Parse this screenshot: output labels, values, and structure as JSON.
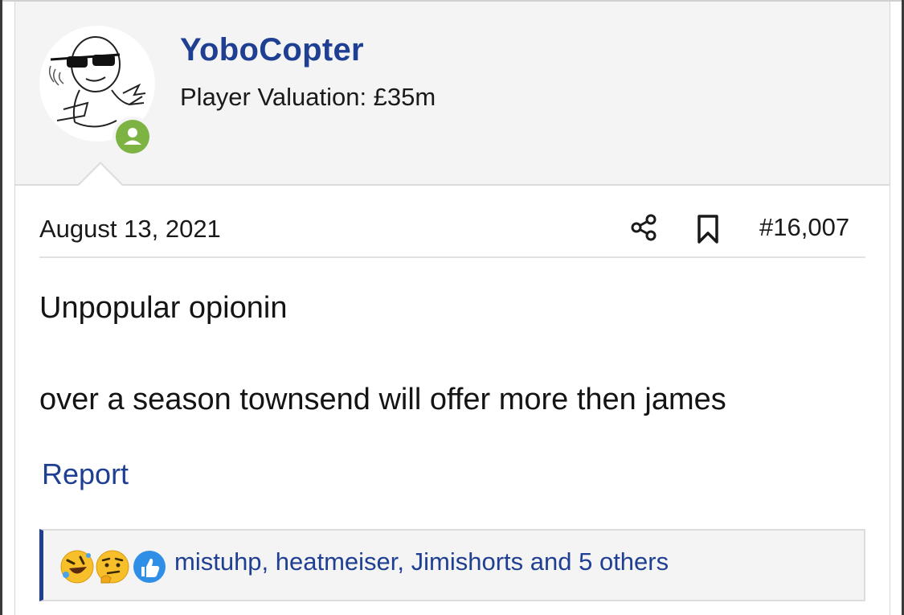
{
  "post": {
    "author": {
      "username": "YoboCopter",
      "title": "Player Valuation: £35m",
      "online_status": "online"
    },
    "date": "August 13, 2021",
    "post_number": "#16,007",
    "body": {
      "line1": "Unpopular opionin",
      "line2": "over a season townsend will offer more then james"
    },
    "actions": {
      "report_label": "Report",
      "share_icon": "share-icon",
      "bookmark_icon": "bookmark-icon"
    },
    "reactions": {
      "icons": [
        "rofl-emoji",
        "thinking-emoji",
        "thumbs-up"
      ],
      "summary": "mistuhp, heatmeiser, Jimishorts and 5 others"
    }
  },
  "colors": {
    "accent": "#1f3f92",
    "online": "#7cb342",
    "header_bg": "#f4f4f4"
  }
}
